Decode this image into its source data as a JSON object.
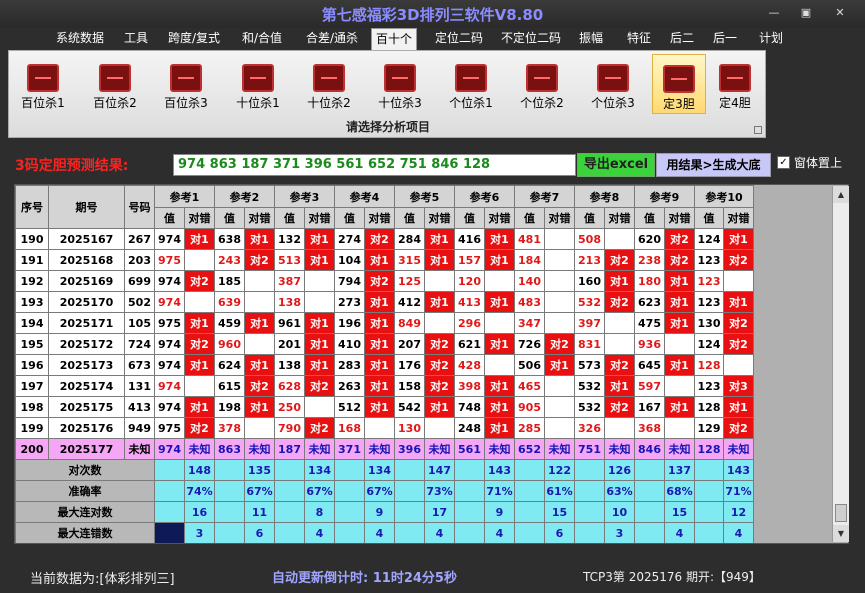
{
  "window": {
    "title": "第七感福彩3D排列三软件V8.80",
    "minimize": "—",
    "maximize": "▣",
    "close": "✕"
  },
  "menu": [
    "系统数据",
    "工具",
    "跨度/复式",
    "和/合值",
    "合差/通杀",
    "百十个",
    "定位二码",
    "不定位二码",
    "振幅",
    "特征",
    "后二",
    "后一",
    "计划"
  ],
  "menu_active": 5,
  "ribbon": {
    "buttons": [
      "百位杀1",
      "百位杀2",
      "百位杀3",
      "十位杀1",
      "十位杀2",
      "十位杀3",
      "个位杀1",
      "个位杀2",
      "个位杀3",
      "定3胆",
      "定4胆"
    ],
    "active": 9,
    "caption": "请选择分析项目",
    "icon": "chart-icon"
  },
  "prediction": {
    "label": "3码定胆预测结果:",
    "value": "974 863 187 371 396 561 652 751 846 128",
    "export_button": "导出excel",
    "generate_button": "用结果>生成大底",
    "checkbox_label": "窗体置上",
    "checkbox_checked": "✓"
  },
  "grid": {
    "fixed_headers": [
      "序号",
      "期号",
      "号码"
    ],
    "groups": [
      "参考1",
      "参考2",
      "参考3",
      "参考4",
      "参考5",
      "参考6",
      "参考7",
      "参考8",
      "参考9",
      "参考10"
    ],
    "sub_headers": [
      "值",
      "对错"
    ],
    "rows": [
      {
        "seq": "190",
        "period": "2025167",
        "num": "267",
        "vals": [
          "974",
          "638",
          "132",
          "274",
          "284",
          "416",
          "481",
          "508",
          "620",
          "124"
        ],
        "marks": [
          "对1",
          "对1",
          "对1",
          "对2",
          "对1",
          "对1",
          "",
          "",
          "对2",
          "对1"
        ]
      },
      {
        "seq": "191",
        "period": "2025168",
        "num": "203",
        "vals": [
          "975",
          "243",
          "513",
          "104",
          "315",
          "157",
          "184",
          "213",
          "238",
          "123"
        ],
        "marks": [
          "",
          "对2",
          "对1",
          "对1",
          "对1",
          "对1",
          "",
          "对2",
          "对2",
          "对2"
        ]
      },
      {
        "seq": "192",
        "period": "2025169",
        "num": "699",
        "vals": [
          "974",
          "185",
          "387",
          "794",
          "125",
          "120",
          "140",
          "160",
          "180",
          "123"
        ],
        "marks": [
          "对2",
          "",
          "",
          "对2",
          "",
          "",
          "",
          "对1",
          "对1",
          ""
        ]
      },
      {
        "seq": "193",
        "period": "2025170",
        "num": "502",
        "vals": [
          "974",
          "639",
          "138",
          "273",
          "412",
          "413",
          "483",
          "532",
          "623",
          "123"
        ],
        "marks": [
          "",
          "",
          "",
          "对1",
          "对1",
          "对1",
          "",
          "对2",
          "对1",
          "对1"
        ]
      },
      {
        "seq": "194",
        "period": "2025171",
        "num": "105",
        "vals": [
          "975",
          "459",
          "961",
          "196",
          "849",
          "296",
          "347",
          "397",
          "475",
          "130"
        ],
        "marks": [
          "对1",
          "对1",
          "对1",
          "对1",
          "",
          "",
          "",
          "",
          "对1",
          "对2"
        ]
      },
      {
        "seq": "195",
        "period": "2025172",
        "num": "724",
        "vals": [
          "974",
          "960",
          "201",
          "410",
          "207",
          "621",
          "726",
          "831",
          "936",
          "124"
        ],
        "marks": [
          "对2",
          "",
          "对1",
          "对1",
          "对2",
          "对1",
          "对2",
          "",
          "",
          "对2"
        ]
      },
      {
        "seq": "196",
        "period": "2025173",
        "num": "673",
        "vals": [
          "974",
          "624",
          "138",
          "283",
          "176",
          "428",
          "506",
          "573",
          "645",
          "128"
        ],
        "marks": [
          "对1",
          "对1",
          "对1",
          "对1",
          "对2",
          "",
          "对1",
          "对2",
          "对1",
          ""
        ]
      },
      {
        "seq": "197",
        "period": "2025174",
        "num": "131",
        "vals": [
          "974",
          "615",
          "628",
          "263",
          "158",
          "398",
          "465",
          "532",
          "597",
          "123"
        ],
        "marks": [
          "",
          "对2",
          "对2",
          "对1",
          "对2",
          "对1",
          "",
          "对1",
          "",
          "对3"
        ]
      },
      {
        "seq": "198",
        "period": "2025175",
        "num": "413",
        "vals": [
          "974",
          "198",
          "250",
          "512",
          "542",
          "748",
          "905",
          "532",
          "167",
          "128"
        ],
        "marks": [
          "对1",
          "对1",
          "",
          "对1",
          "对1",
          "对1",
          "",
          "对2",
          "对1",
          "对1"
        ]
      },
      {
        "seq": "199",
        "period": "2025176",
        "num": "949",
        "vals": [
          "975",
          "378",
          "790",
          "168",
          "130",
          "248",
          "285",
          "326",
          "368",
          "129"
        ],
        "marks": [
          "对2",
          "",
          "对2",
          "",
          "",
          "对1",
          "",
          "",
          "",
          "对2"
        ]
      }
    ],
    "red_vals": [
      [
        6,
        7
      ],
      [
        0,
        1,
        2,
        4,
        5,
        6,
        7,
        8
      ],
      [
        2,
        4,
        5,
        6,
        8,
        9
      ],
      [
        0,
        1,
        2,
        5,
        6,
        7
      ],
      [
        4,
        5,
        6,
        7
      ],
      [
        1,
        7,
        8
      ],
      [
        5,
        9
      ],
      [
        0,
        2,
        5,
        6,
        8
      ],
      [
        2,
        6
      ],
      [
        1,
        2,
        3,
        4,
        6,
        7,
        8
      ]
    ],
    "pred_row": {
      "seq": "200",
      "period": "2025177",
      "num": "未知",
      "vals": [
        "974",
        "863",
        "187",
        "371",
        "396",
        "561",
        "652",
        "751",
        "846",
        "128"
      ],
      "mark": "未知"
    },
    "stats": [
      {
        "label": "对次数",
        "values": [
          "148",
          "135",
          "134",
          "134",
          "147",
          "143",
          "122",
          "126",
          "137",
          "143"
        ]
      },
      {
        "label": "准确率",
        "values": [
          "74%",
          "67%",
          "67%",
          "67%",
          "73%",
          "71%",
          "61%",
          "63%",
          "68%",
          "71%"
        ]
      },
      {
        "label": "最大连对数",
        "values": [
          "16",
          "11",
          "8",
          "9",
          "17",
          "9",
          "15",
          "10",
          "15",
          "12"
        ]
      },
      {
        "label": "最大连错数",
        "values": [
          "3",
          "6",
          "4",
          "4",
          "4",
          "4",
          "6",
          "3",
          "4",
          "4"
        ]
      }
    ]
  },
  "status": {
    "current": "当前数据为:[体彩排列三]",
    "countdown": "自动更新倒计时: 11时24分5秒",
    "draw": "TCP3第 2025176 期开:【949】"
  }
}
